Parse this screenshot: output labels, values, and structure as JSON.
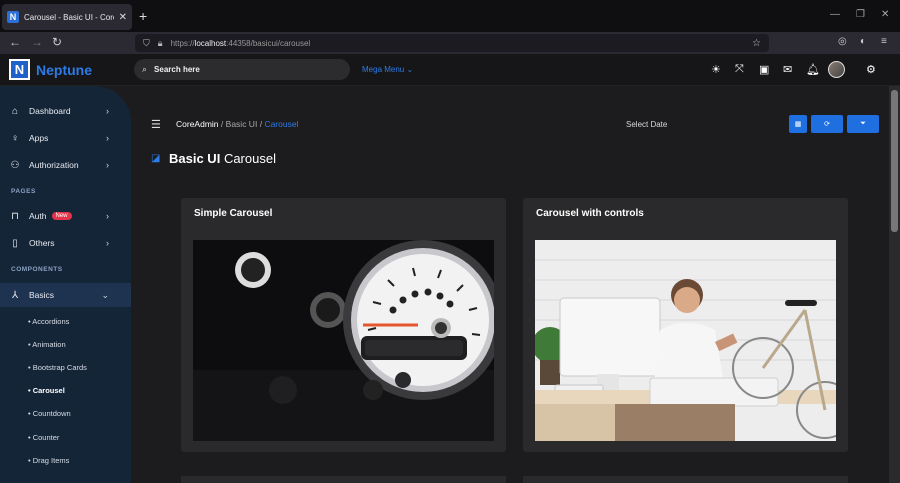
{
  "browser": {
    "tab_title": "Carousel - Basic UI - CoreAdmin",
    "favicon": "N",
    "new_tab": "+",
    "url_prefix": "https://",
    "url_host": "localhost",
    "url_rest": ":44358/basicui/carousel"
  },
  "header": {
    "logo_letter": "N",
    "brand": "Neptune",
    "search_placeholder": "Search here",
    "mega_menu": "Mega Menu"
  },
  "sidebar": {
    "items": [
      {
        "label": "Dashboard"
      },
      {
        "label": "Apps"
      },
      {
        "label": "Authorization"
      },
      {
        "label": "Auth",
        "badge": "New"
      },
      {
        "label": "Others"
      },
      {
        "label": "Basics"
      }
    ],
    "sections": [
      "PAGES",
      "COMPONENTS"
    ],
    "sub_items": [
      "Accordions",
      "Animation",
      "Bootstrap Cards",
      "Carousel",
      "Countdown",
      "Counter",
      "Drag Items"
    ]
  },
  "toolbar": {
    "breadcrumb": [
      "CoreAdmin",
      "Basic UI",
      "Carousel"
    ],
    "separator": "/",
    "select_date": "Select Date"
  },
  "page": {
    "title_bold": "Basic UI",
    "title_rest": "Carousel"
  },
  "cards": [
    {
      "title": "Simple Carousel"
    },
    {
      "title": "Carousel with controls"
    }
  ],
  "colors": {
    "accent": "#2d7be6",
    "sidebar_bg": "#152538",
    "badge": "#e0344a"
  }
}
